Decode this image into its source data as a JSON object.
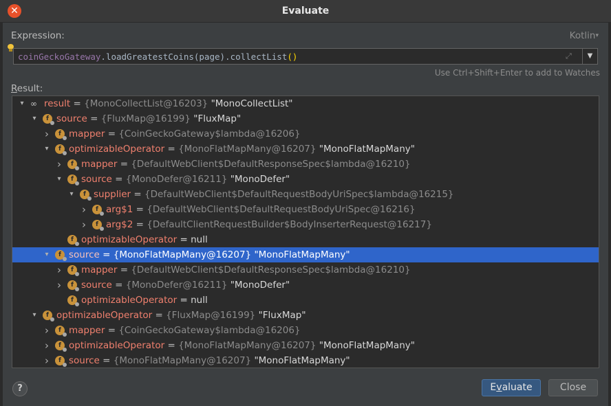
{
  "window": {
    "title": "Evaluate"
  },
  "expression": {
    "label": "Expression:",
    "language": "Kotlin",
    "receiver": "coinGeckoGateway",
    "call": ".loadGreatestCoins(page).collectList",
    "parens": "()",
    "hint": "Use Ctrl+Shift+Enter to add to Watches"
  },
  "result": {
    "label_first": "R",
    "label_rest": "esult:"
  },
  "tree": [
    {
      "indent": 0,
      "chevron": "open",
      "icon": "glasses",
      "name": "result",
      "type": "{MonoCollectList@16203}",
      "value": "\"MonoCollectList\""
    },
    {
      "indent": 1,
      "chevron": "open",
      "icon": "field",
      "name": "source",
      "type": "{FluxMap@16199}",
      "value": "\"FluxMap\""
    },
    {
      "indent": 2,
      "chevron": "closed",
      "icon": "field",
      "name": "mapper",
      "type": "{CoinGeckoGateway$lambda@16206}",
      "value": ""
    },
    {
      "indent": 2,
      "chevron": "open",
      "icon": "field",
      "name": "optimizableOperator",
      "type": "{MonoFlatMapMany@16207}",
      "value": "\"MonoFlatMapMany\""
    },
    {
      "indent": 3,
      "chevron": "closed",
      "icon": "field",
      "name": "mapper",
      "type": "{DefaultWebClient$DefaultResponseSpec$lambda@16210}",
      "value": ""
    },
    {
      "indent": 3,
      "chevron": "open",
      "icon": "field",
      "name": "source",
      "type": "{MonoDefer@16211}",
      "value": "\"MonoDefer\""
    },
    {
      "indent": 4,
      "chevron": "open",
      "icon": "field",
      "name": "supplier",
      "type": "{DefaultWebClient$DefaultRequestBodyUriSpec$lambda@16215}",
      "value": ""
    },
    {
      "indent": 5,
      "chevron": "closed",
      "icon": "field",
      "name": "arg$1",
      "type": "{DefaultWebClient$DefaultRequestBodyUriSpec@16216}",
      "value": ""
    },
    {
      "indent": 5,
      "chevron": "closed",
      "icon": "field",
      "name": "arg$2",
      "type": "{DefaultClientRequestBuilder$BodyInserterRequest@16217}",
      "value": ""
    },
    {
      "indent": 3,
      "chevron": "none",
      "icon": "field",
      "name": "optimizableOperator",
      "type": "= null",
      "value": "",
      "null": true
    },
    {
      "indent": 2,
      "chevron": "open",
      "icon": "field",
      "name": "source",
      "type": "{MonoFlatMapMany@16207}",
      "value": "\"MonoFlatMapMany\"",
      "selected": true
    },
    {
      "indent": 3,
      "chevron": "closed",
      "icon": "field",
      "name": "mapper",
      "type": "{DefaultWebClient$DefaultResponseSpec$lambda@16210}",
      "value": ""
    },
    {
      "indent": 3,
      "chevron": "closed",
      "icon": "field",
      "name": "source",
      "type": "{MonoDefer@16211}",
      "value": "\"MonoDefer\""
    },
    {
      "indent": 3,
      "chevron": "none",
      "icon": "field",
      "name": "optimizableOperator",
      "type": "= null",
      "value": "",
      "null": true
    },
    {
      "indent": 1,
      "chevron": "open",
      "icon": "field",
      "name": "optimizableOperator",
      "type": "{FluxMap@16199}",
      "value": "\"FluxMap\""
    },
    {
      "indent": 2,
      "chevron": "closed",
      "icon": "field",
      "name": "mapper",
      "type": "{CoinGeckoGateway$lambda@16206}",
      "value": ""
    },
    {
      "indent": 2,
      "chevron": "closed",
      "icon": "field",
      "name": "optimizableOperator",
      "type": "{MonoFlatMapMany@16207}",
      "value": "\"MonoFlatMapMany\""
    },
    {
      "indent": 2,
      "chevron": "closed",
      "icon": "field",
      "name": "source",
      "type": "{MonoFlatMapMany@16207}",
      "value": "\"MonoFlatMapMany\""
    }
  ],
  "buttons": {
    "help": "?",
    "evaluate_first": "E",
    "evaluate_underlined": "v",
    "evaluate_rest": "aluate",
    "close": "Close"
  },
  "colors": {
    "accent_selection": "#2f65ca",
    "field_name": "#f0806e",
    "field_icon": "#c9923a",
    "close_icon": "#e8512a"
  }
}
